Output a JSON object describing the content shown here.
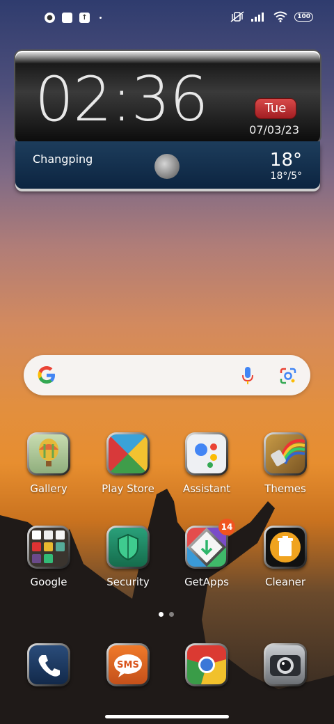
{
  "status_bar": {
    "battery": "100",
    "left_icons": [
      "notification-icon",
      "square-icon",
      "upload-icon"
    ],
    "right_icons": [
      "vibrate-off-icon",
      "signal-icon",
      "wifi-icon",
      "battery-icon"
    ]
  },
  "clock_widget": {
    "time": "02:36",
    "day": "Tue",
    "date": "07/03/23",
    "city": "Changping",
    "temperature": "18°",
    "temp_range": "18°/5°",
    "weather_icon": "moon-icon"
  },
  "search": {
    "icons": [
      "google-logo-icon",
      "mic-icon",
      "lens-icon"
    ]
  },
  "apps": [
    {
      "label": "Gallery",
      "icon": "gallery-icon"
    },
    {
      "label": "Play Store",
      "icon": "play-store-icon"
    },
    {
      "label": "Assistant",
      "icon": "assistant-icon"
    },
    {
      "label": "Themes",
      "icon": "themes-icon"
    },
    {
      "label": "Google",
      "icon": "google-folder-icon"
    },
    {
      "label": "Security",
      "icon": "security-icon"
    },
    {
      "label": "GetApps",
      "icon": "getapps-icon",
      "badge": "14"
    },
    {
      "label": "Cleaner",
      "icon": "cleaner-icon"
    }
  ],
  "dock": [
    {
      "icon": "phone-icon"
    },
    {
      "icon": "sms-icon",
      "text": "SMS"
    },
    {
      "icon": "chrome-icon"
    },
    {
      "icon": "camera-icon"
    }
  ],
  "page_indicator": {
    "count": 2,
    "active": 1
  },
  "colors": {
    "accent_red": "#c22b2b",
    "badge_orange": "#f0541f",
    "weather_blue": "#0c2440"
  }
}
